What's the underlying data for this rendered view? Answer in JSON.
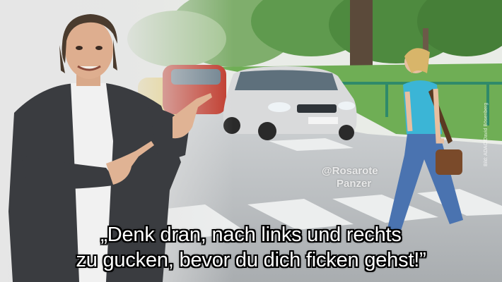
{
  "meme": {
    "caption_line1": "„Denk dran, nach links und rechts",
    "caption_line2": "zu gucken, bevor du dich ficken gehst!”",
    "watermark_handle": "@Rosarote",
    "watermark_name": "Panzer",
    "photo_credit": "Bild: ADAC/David Bösenberg"
  },
  "colors": {
    "caption_text": "#ffffff",
    "caption_outline": "#000000",
    "sky": "#e8ece6",
    "road": "#b9bcbf",
    "grass": "#6aa84f",
    "car_silver": "#d9dadb",
    "car_red": "#c0392b",
    "car_yellow": "#e9c84b",
    "jacket": "#3a3c40",
    "woman_top": "#3bb5d6",
    "woman_jeans": "#4a73b0"
  }
}
